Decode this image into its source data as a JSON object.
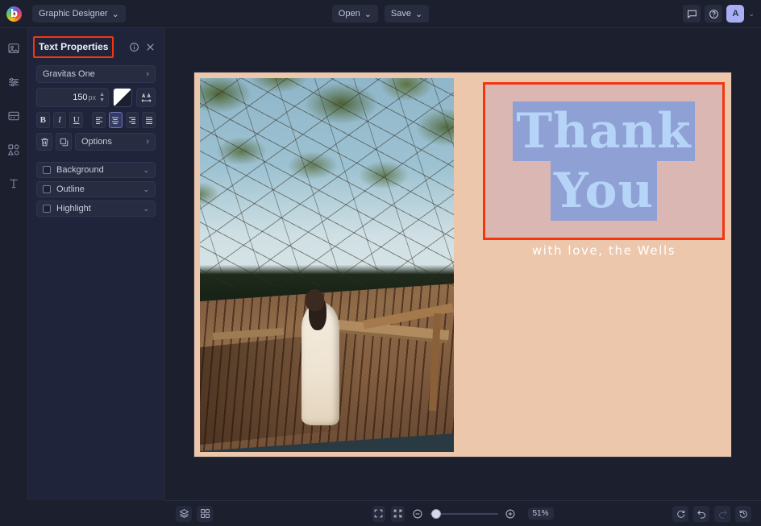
{
  "app": {
    "logo_icon": "befunky-logo-icon",
    "switcher_label": "Graphic Designer",
    "switcher_caret": "⌄"
  },
  "topbar": {
    "open_label": "Open",
    "open_caret": "⌄",
    "save_label": "Save",
    "save_caret": "⌄",
    "feedback_icon": "comment-icon",
    "help_icon": "help-circle-icon",
    "avatar_initial": "A",
    "avatar_caret": "⌄",
    "avatar_color": "#a8aff5"
  },
  "rail": {
    "items": [
      {
        "name": "sidebar-item-image",
        "icon": "image-icon"
      },
      {
        "name": "sidebar-item-adjust",
        "icon": "sliders-icon"
      },
      {
        "name": "sidebar-item-frames",
        "icon": "frames-icon"
      },
      {
        "name": "sidebar-item-graphics",
        "icon": "shapes-icon"
      },
      {
        "name": "sidebar-item-text",
        "icon": "text-icon"
      }
    ]
  },
  "panel": {
    "title": "Text Properties",
    "title_outline_color": "#f4360f",
    "info_icon": "info-circle-icon",
    "close_icon": "close-icon",
    "font": {
      "value": "Gravitas One",
      "caret": "›"
    },
    "size": {
      "value": "150",
      "unit": "px",
      "increment_icon": "caret-up-icon",
      "decrement_icon": "caret-down-icon"
    },
    "color_swatch": {
      "name": "text-color-swatch",
      "fill": "#ffffff"
    },
    "letter_spacing_icon": "letter-spacing-icon",
    "style_buttons": [
      {
        "name": "bold-button",
        "label": "B",
        "active": false
      },
      {
        "name": "italic-button",
        "label": "I",
        "active": false
      },
      {
        "name": "underline-button",
        "label": "U",
        "active": false
      }
    ],
    "align_buttons": [
      {
        "name": "align-left-button",
        "active": false
      },
      {
        "name": "align-center-button",
        "active": true
      },
      {
        "name": "align-right-button",
        "active": false
      },
      {
        "name": "align-justify-button",
        "active": false
      }
    ],
    "delete_icon": "trash-icon",
    "duplicate_icon": "duplicate-icon",
    "options": {
      "label": "Options",
      "caret": "›"
    },
    "toggles": [
      {
        "name": "background-toggle",
        "label": "Background",
        "checked": false,
        "caret": "⌄"
      },
      {
        "name": "outline-toggle",
        "label": "Outline",
        "checked": false,
        "caret": "⌄"
      },
      {
        "name": "highlight-toggle",
        "label": "Highlight",
        "checked": false,
        "caret": "⌄"
      }
    ]
  },
  "canvas": {
    "background_color": "#edc7ac",
    "selection_border_color": "#f4360f",
    "text_lines": [
      "Thank",
      "You"
    ],
    "text_color": "#b6d4f7",
    "selection_highlight_color": "#8fa0d4",
    "signature": "with love, the Wells",
    "signature_color": "#ffffff",
    "photo_alt": "pregnant-woman-on-lake-dock-photo"
  },
  "bottombar": {
    "layers_icon": "layers-icon",
    "grid_icon": "grid-icon",
    "fit_icon": "fit-to-screen-icon",
    "fullscreen_icon": "expand-icon",
    "zoom_out_icon": "zoom-out-icon",
    "zoom_in_icon": "zoom-in-icon",
    "zoom_percent": "51%",
    "reset_icon": "reset-icon",
    "undo_icon": "undo-icon",
    "redo_icon": "redo-icon",
    "history_icon": "history-icon"
  }
}
